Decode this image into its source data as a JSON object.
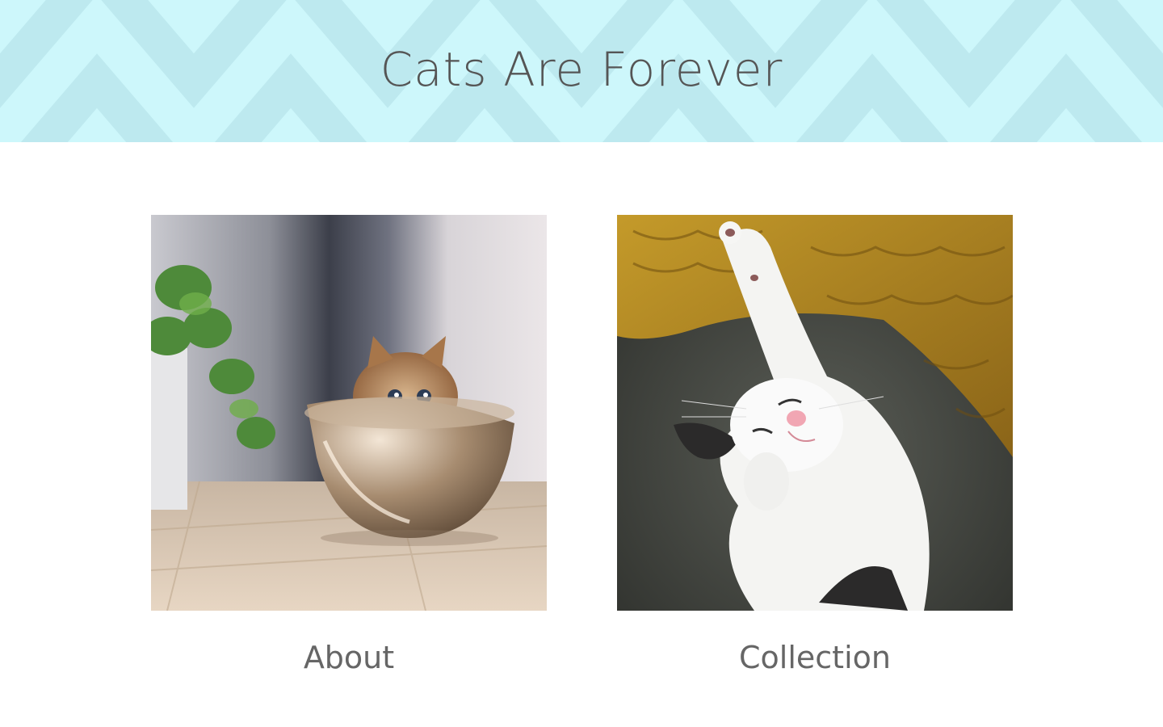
{
  "header": {
    "title": "Cats Are Forever",
    "background": "#cdf7fb",
    "pattern_color": "#bfeaf0"
  },
  "cards": [
    {
      "label": "About",
      "image": "kitten-in-metal-bowl"
    },
    {
      "label": "Collection",
      "image": "white-kitten-stretching-on-blanket"
    }
  ],
  "colors": {
    "title_text": "#555555",
    "label_text": "#666666"
  }
}
